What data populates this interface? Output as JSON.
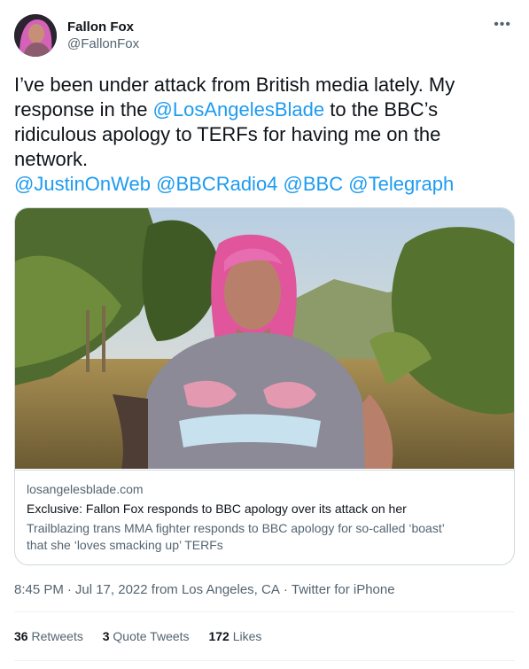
{
  "author": {
    "name": "Fallon Fox",
    "handle": "@FallonFox"
  },
  "more_label": "•••",
  "tweet": {
    "line1": "I’ve been under attack from British media lately. My",
    "line2_before": "response in the ",
    "line2_mention": "@LosAngelesBlade",
    "line2_after": " to the BBC’s",
    "line3": "ridiculous apology to TERFs for having me on the",
    "line4": "network.",
    "mentions": [
      "@JustinOnWeb",
      "@BBCRadio4",
      "@BBC",
      "@Telegraph"
    ]
  },
  "card": {
    "domain": "losangelesblade.com",
    "title": "Exclusive: Fallon Fox responds to BBC apology over its attack on her",
    "description_line1": "Trailblazing trans MMA fighter responds to BBC apology for so-called ‘boast’",
    "description_line2": "that she ‘loves smacking up’ TERFs"
  },
  "meta": {
    "time": "8:45 PM",
    "date": "Jul 17, 2022",
    "location": "from Los Angeles, CA",
    "source": "Twitter for iPhone",
    "separator": "·"
  },
  "stats": {
    "retweets_count": "36",
    "retweets_label": "Retweets",
    "quotes_count": "3",
    "quotes_label": "Quote Tweets",
    "likes_count": "172",
    "likes_label": "Likes"
  },
  "colors": {
    "link": "#1d9bf0",
    "secondary_text": "#536471",
    "border": "#cfd9de"
  }
}
